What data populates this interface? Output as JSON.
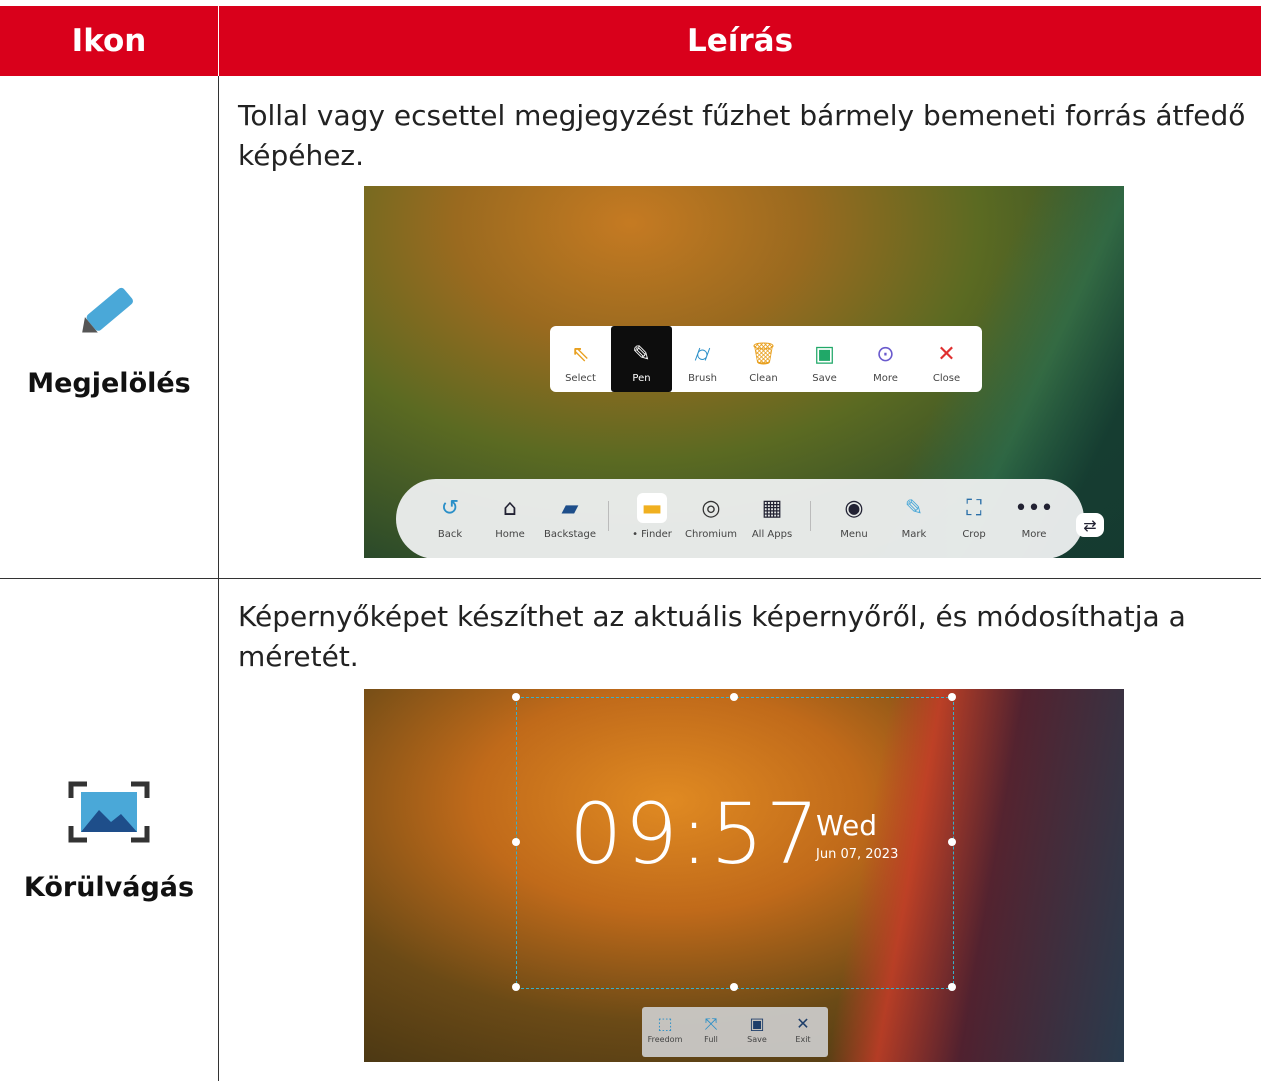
{
  "header": {
    "col_icon": "Ikon",
    "col_desc": "Leírás"
  },
  "rows": [
    {
      "label": "Megjelölés",
      "icon": "pen-icon",
      "description": "Tollal vagy ecsettel megjegyzést fűzhet bármely bemeneti forrás átfedő képéhez.",
      "toolbar": [
        {
          "label": "Select",
          "icon": "select-arrow-icon"
        },
        {
          "label": "Pen",
          "icon": "pen-icon"
        },
        {
          "label": "Brush",
          "icon": "brush-icon"
        },
        {
          "label": "Clean",
          "icon": "trash-icon"
        },
        {
          "label": "Save",
          "icon": "save-icon"
        },
        {
          "label": "More",
          "icon": "more-icon"
        },
        {
          "label": "Close",
          "icon": "close-icon"
        }
      ],
      "dock": [
        {
          "label": "Back",
          "icon": "back-icon"
        },
        {
          "label": "Home",
          "icon": "home-icon"
        },
        {
          "label": "Backstage",
          "icon": "backstage-icon"
        },
        {
          "label": "• Finder",
          "icon": "finder-icon"
        },
        {
          "label": "Chromium",
          "icon": "chromium-icon"
        },
        {
          "label": "All Apps",
          "icon": "all-apps-icon"
        },
        {
          "label": "Menu",
          "icon": "menu-icon"
        },
        {
          "label": "Mark",
          "icon": "mark-icon"
        },
        {
          "label": "Crop",
          "icon": "crop-icon"
        },
        {
          "label": "More",
          "icon": "more-icon"
        }
      ]
    },
    {
      "label": "Körülvágás",
      "icon": "crop-icon",
      "description": "Képernyőképet készíthet az aktuális képernyőről, és módosíthatja a méretét.",
      "clock": {
        "time": "09:57",
        "day": "Wed",
        "date": "Jun 07, 2023"
      },
      "toolbar": [
        {
          "label": "Freedom",
          "icon": "freedom-icon"
        },
        {
          "label": "Full",
          "icon": "full-icon"
        },
        {
          "label": "Save",
          "icon": "save-icon"
        },
        {
          "label": "Exit",
          "icon": "exit-icon"
        }
      ]
    }
  ],
  "colors": {
    "header_bg": "#d9001b",
    "accent_blue": "#4aa8d8"
  }
}
